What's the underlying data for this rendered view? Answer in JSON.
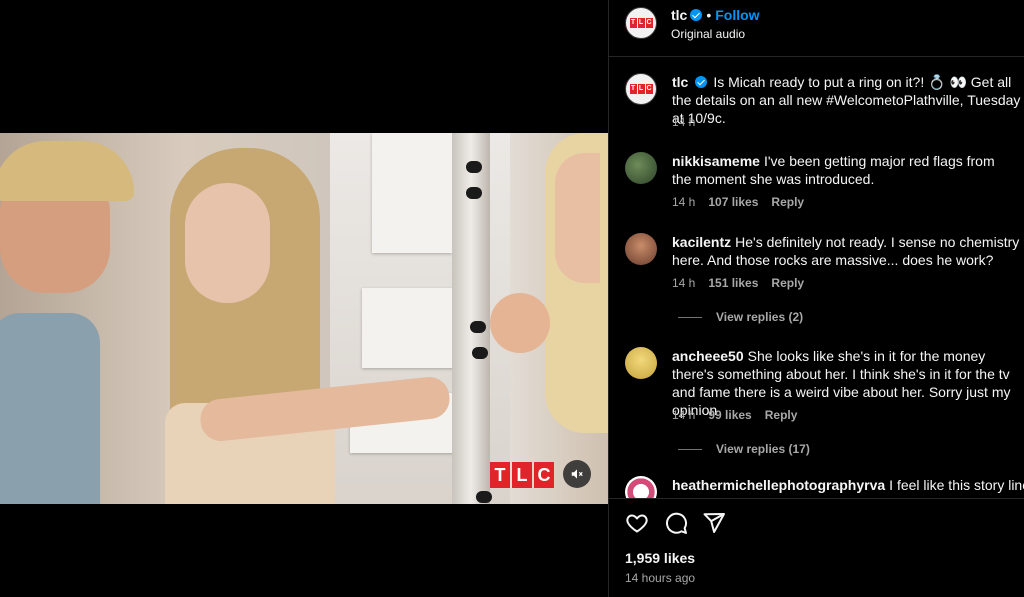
{
  "media": {
    "watermark": [
      "T",
      "L",
      "C"
    ],
    "mute_icon": "speaker-muted-icon"
  },
  "header": {
    "username": "tlc",
    "follow_label": "Follow",
    "separator": "•",
    "audio_label": "Original audio"
  },
  "caption": {
    "username": "tlc",
    "text": "Is Micah ready to put a ring on it?! 💍 👀 Get all the details on an all new #WelcometoPlathville, Tuesday at 10/9c.",
    "time": "14 h"
  },
  "comments": [
    {
      "username": "nikkisameme",
      "text": "I've been getting major red flags from the moment she was introduced.",
      "time": "14 h",
      "likes": "107 likes",
      "reply": "Reply",
      "view_replies": ""
    },
    {
      "username": "kacilentz",
      "text": "He's definitely not ready. I sense no chemistry here. And those rocks are massive... does he work?",
      "time": "14 h",
      "likes": "151 likes",
      "reply": "Reply",
      "view_replies": "View replies (2)"
    },
    {
      "username": "ancheee50",
      "text": "She looks like she's in it for the money there's something about her. I think she's in it for the tv and fame there is a weird vibe about her. Sorry just my opinion",
      "time": "14 h",
      "likes": "99 likes",
      "reply": "Reply",
      "view_replies": "View replies (17)"
    },
    {
      "username": "heathermichellephotographyrva",
      "text": "I feel like this story line is",
      "time": "",
      "likes": "",
      "reply": "",
      "view_replies": ""
    }
  ],
  "actions": {
    "like_icon": "heart-icon",
    "comment_icon": "comment-bubble-icon",
    "share_icon": "paper-plane-icon",
    "likes_count": "1,959 likes",
    "posted_ago": "14 hours ago"
  },
  "colors": {
    "background": "#000000",
    "text_primary": "#f5f5f5",
    "text_secondary": "#a8a8a8",
    "link_blue": "#0095f6",
    "tlc_red": "#e1242a",
    "divider": "#262626"
  }
}
